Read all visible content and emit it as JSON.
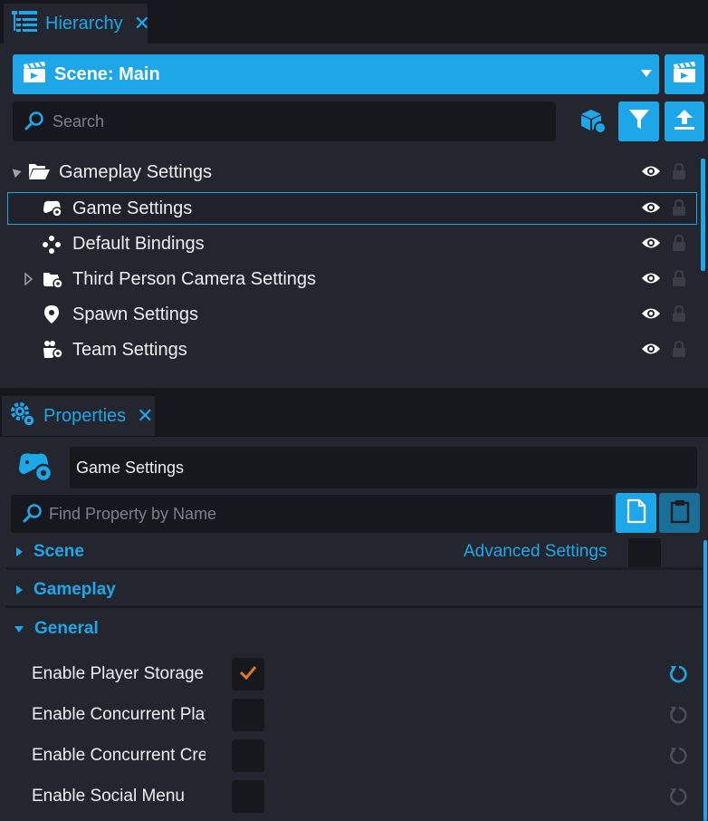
{
  "hierarchy": {
    "tab_label": "Hierarchy",
    "tab_close": "✕",
    "scene_label": "Scene: Main",
    "search_placeholder": "Search",
    "items": [
      {
        "label": "Gameplay Settings",
        "icon": "folder-open-icon",
        "expander": "expanded"
      },
      {
        "label": "Game Settings",
        "icon": "gamepad-gear-icon",
        "selected": true
      },
      {
        "label": "Default Bindings",
        "icon": "bindings-icon"
      },
      {
        "label": "Third Person Camera Settings",
        "icon": "camera-settings-icon",
        "expander": "collapsed"
      },
      {
        "label": "Spawn Settings",
        "icon": "map-pin-icon"
      },
      {
        "label": "Team Settings",
        "icon": "team-gear-icon"
      }
    ]
  },
  "properties": {
    "tab_label": "Properties",
    "tab_close": "✕",
    "object_name": "Game Settings",
    "find_placeholder": "Find Property by Name",
    "advanced_label": "Advanced Settings",
    "sections": {
      "scene": "Scene",
      "gameplay": "Gameplay",
      "general": "General"
    },
    "rows": [
      {
        "label": "Enable Player Storage",
        "checked": true
      },
      {
        "label": "Enable Concurrent Player Storage",
        "checked": false
      },
      {
        "label": "Enable Concurrent Creator Storage",
        "checked": false
      },
      {
        "label": "Enable Social Menu",
        "checked": false
      }
    ]
  },
  "colors": {
    "accent": "#1ea7e8",
    "panel": "#24262f",
    "background": "#16171c",
    "field": "#17181d",
    "check": "#e07b22"
  }
}
